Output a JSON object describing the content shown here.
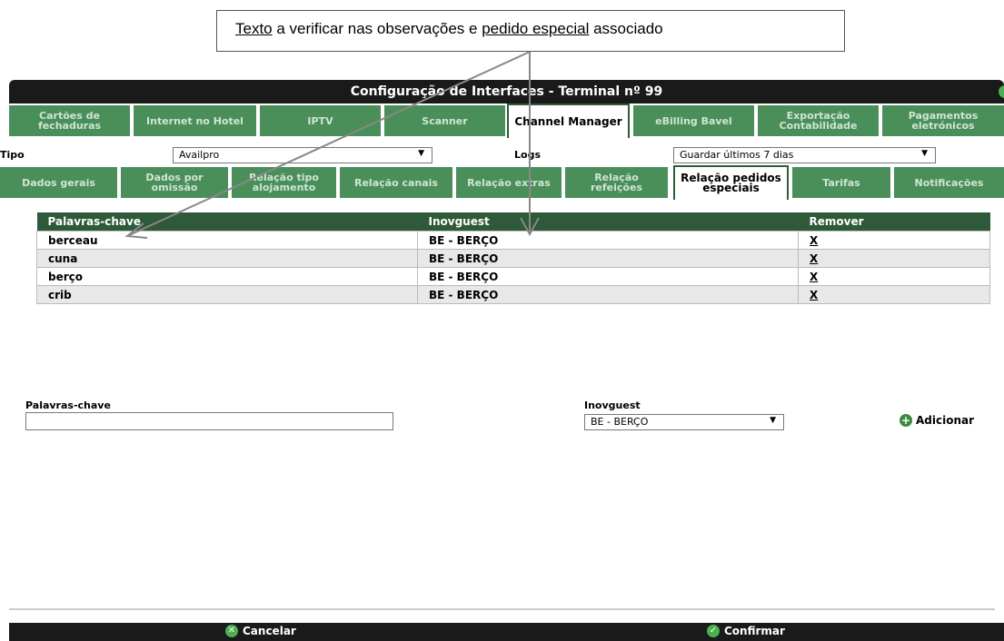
{
  "callout": {
    "word1": "Texto",
    "mid": " a verificar nas observações e ",
    "word2": "pedido especial",
    "end": " associado"
  },
  "window": {
    "title": "Configuração de Interfaces - Terminal nº 99"
  },
  "tabs": [
    "Cartões de fechaduras",
    "Internet no Hotel",
    "IPTV",
    "Scanner",
    "Channel Manager",
    "eBilling Bavel",
    "Exportação Contabilidade",
    "Pagamentos eletrónicos"
  ],
  "row1": {
    "tipo_label": "Tipo",
    "tipo_value": "Availpro",
    "logs_label": "Logs",
    "logs_value": "Guardar últimos 7 dias"
  },
  "subtabs": [
    "Dados gerais",
    "Dados por omissão",
    "Relação tipo alojamento",
    "Relação canais",
    "Relação extras",
    "Relação refeições",
    "Relação pedidos especiais",
    "Tarifas",
    "Notificações"
  ],
  "table": {
    "headers": [
      "Palavras-chave",
      "Inovguest",
      "Remover"
    ],
    "rows": [
      [
        "berceau",
        "BE - BERÇO",
        "X"
      ],
      [
        "cuna",
        "BE - BERÇO",
        "X"
      ],
      [
        "berço",
        "BE - BERÇO",
        "X"
      ],
      [
        "crib",
        "BE - BERÇO",
        "X"
      ]
    ]
  },
  "form": {
    "keyword_label": "Palavras-chave",
    "keyword_value": "",
    "inov_label": "Inovguest",
    "inov_value": "BE - BERÇO",
    "add_label": "Adicionar"
  },
  "footer": {
    "cancel": "Cancelar",
    "confirm": "Confirmar"
  },
  "colors": {
    "tab": "#4a8f5a",
    "header": "#2f5a3a",
    "titlebar": "#1a1a1a"
  }
}
